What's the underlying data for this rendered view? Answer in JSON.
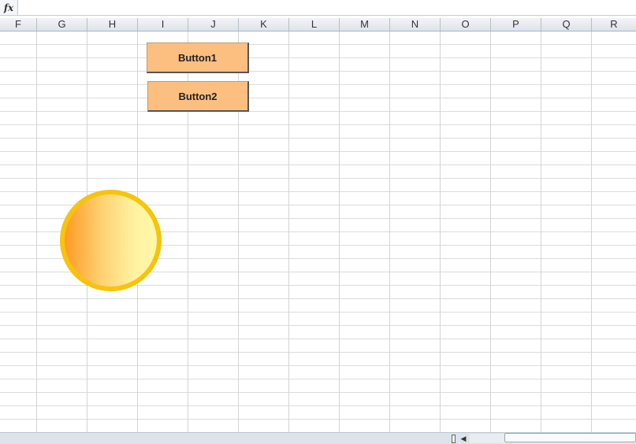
{
  "formula_bar": {
    "fx_label": "fx",
    "value": ""
  },
  "columns": [
    "F",
    "G",
    "H",
    "I",
    "J",
    "K",
    "L",
    "M",
    "N",
    "O",
    "P",
    "Q",
    "R"
  ],
  "sheet_buttons": {
    "button1_label": "Button1",
    "button2_label": "Button2"
  },
  "shape": {
    "type": "circle",
    "fill_gradient": [
      "#fe9a22",
      "#fff8a8"
    ],
    "outline_color": "#f7c40d"
  },
  "colors": {
    "button_fill": "#fdbf80",
    "gridline": "#dadcdd",
    "header_bg": "#dfe4ea"
  },
  "icons": {
    "fx": "function-icon",
    "scroll_left": "arrow-left-icon",
    "split": "split-handle-icon"
  }
}
